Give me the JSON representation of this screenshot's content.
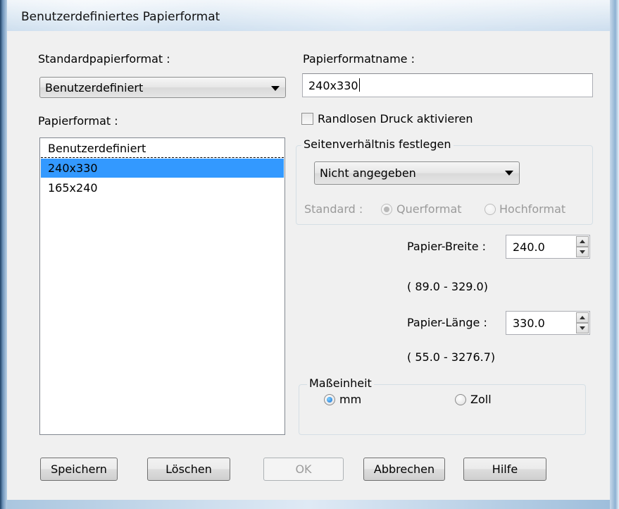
{
  "window": {
    "title": "Benutzerdefiniertes Papierformat"
  },
  "left": {
    "standard_label": "Standardpapierformat :",
    "standard_value": "Benutzerdefiniert",
    "list_label": "Papierformat :",
    "list_items": [
      "Benutzerdefiniert",
      "240x330",
      "165x240"
    ],
    "selected_index": 1
  },
  "right": {
    "name_label": "Papierformatname :",
    "name_value": "240x330",
    "borderless_label": "Randlosen Druck aktivieren",
    "borderless_checked": false,
    "aspect": {
      "title": "Seitenverhältnis festlegen",
      "value": "Nicht angegeben",
      "standard_label": "Standard :",
      "landscape_label": "Querformat",
      "portrait_label": "Hochformat",
      "selected": "Querformat",
      "disabled": true
    },
    "width": {
      "label": "Papier-Breite :",
      "value": "240.0",
      "range": "( 89.0 - 329.0)"
    },
    "length": {
      "label": "Papier-Länge :",
      "value": "330.0",
      "range": "( 55.0 - 3276.7)"
    },
    "unit": {
      "title": "Maßeinheit",
      "mm_label": "mm",
      "inch_label": "Zoll",
      "selected": "mm"
    }
  },
  "buttons": {
    "save": "Speichern",
    "delete": "Löschen",
    "ok": "OK",
    "cancel": "Abbrechen",
    "help": "Hilfe"
  },
  "colors": {
    "selection": "#3399ff",
    "dialog_background": "#f0f0f0",
    "disabled_text": "#9a9a9a"
  }
}
